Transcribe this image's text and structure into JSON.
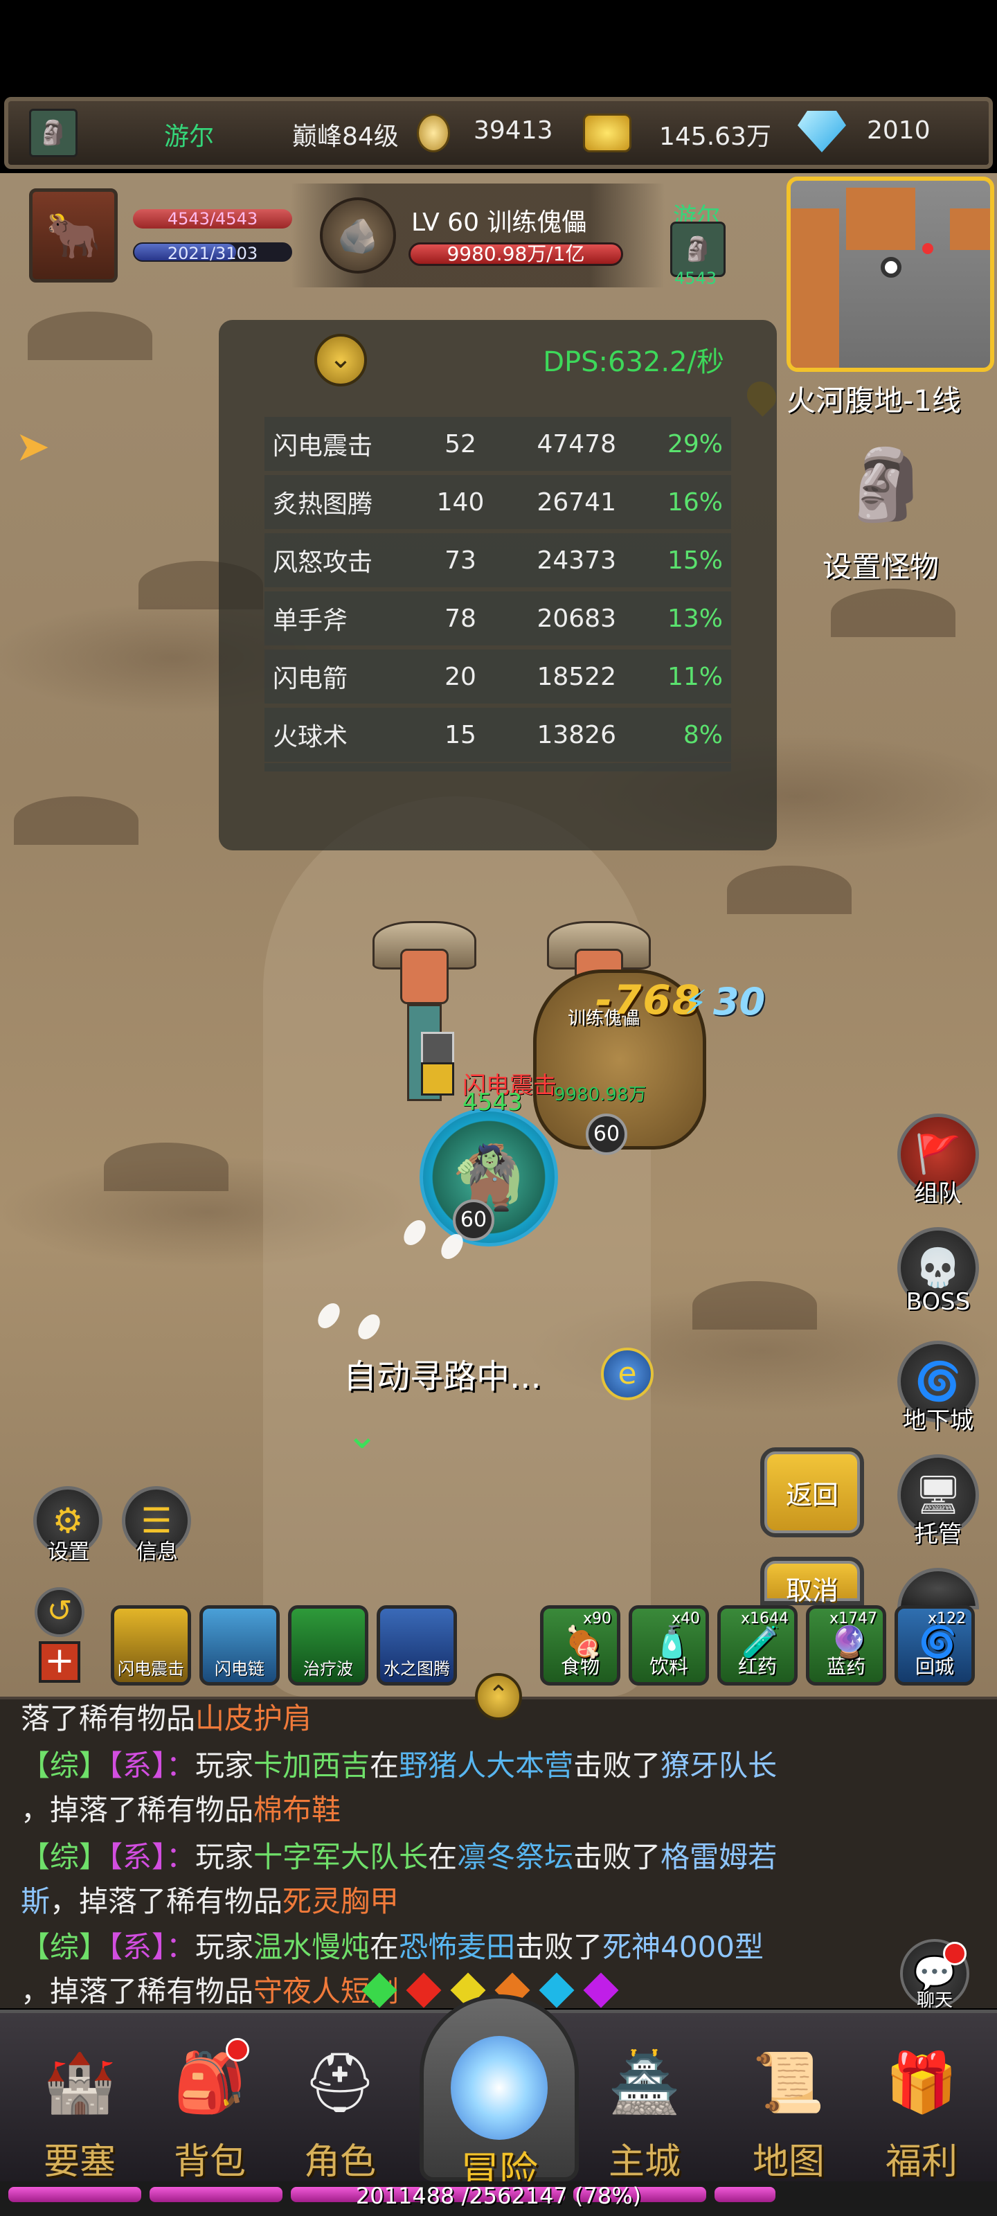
{
  "resources": {
    "player_name": "游尔",
    "rank": "巅峰84级",
    "currency1": "39413",
    "gold": "145.63万",
    "diamonds": "2010"
  },
  "player": {
    "hp": "4543/4543",
    "mp": "2021/3103",
    "mp_fraction": 0.65
  },
  "target": {
    "name": "LV 60 训练傀儡",
    "hp": "9980.98万/1亿",
    "ally_name": "游尔",
    "ally_sub": "4543"
  },
  "map": {
    "location": "火河腹地-1线",
    "set_monster": "设置怪物"
  },
  "dps": {
    "title": "DPS:632.2/秒",
    "rows": [
      {
        "name": "闪电震击",
        "count": "52",
        "damage": "47478",
        "pct": "29%"
      },
      {
        "name": "炙热图腾",
        "count": "140",
        "damage": "26741",
        "pct": "16%"
      },
      {
        "name": "风怒攻击",
        "count": "73",
        "damage": "24373",
        "pct": "15%"
      },
      {
        "name": "单手斧",
        "count": "78",
        "damage": "20683",
        "pct": "13%"
      },
      {
        "name": "闪电箭",
        "count": "20",
        "damage": "18522",
        "pct": "11%"
      },
      {
        "name": "火球术",
        "count": "15",
        "damage": "13826",
        "pct": "8%"
      }
    ]
  },
  "battle": {
    "golem_name": "训练傀儡",
    "golem_hp": "9980.98万",
    "damage": "-768",
    "combo": "30",
    "golem_level": "60",
    "hero_level": "60",
    "pop_skill": "闪电震击",
    "pop_num": "4543",
    "auto_path": "自动寻路中..."
  },
  "right_buttons": [
    {
      "label": "组队",
      "icon": "banner-icon"
    },
    {
      "label": "BOSS",
      "icon": "skull-icon"
    },
    {
      "label": "地下城",
      "icon": "dungeon-icon"
    },
    {
      "label": "托管",
      "icon": "monitor-icon"
    }
  ],
  "left_buttons": {
    "settings": "设置",
    "info": "信息",
    "back": "返回",
    "cancel": "取消"
  },
  "skills": [
    {
      "label": "闪电震击",
      "color": "#e3b528"
    },
    {
      "label": "闪电链",
      "color": "#4aa0d8"
    },
    {
      "label": "治疗波",
      "color": "#2e9a3a"
    },
    {
      "label": "水之图腾",
      "color": "#3a6ab8"
    }
  ],
  "items": [
    {
      "label": "食物",
      "qty": "x90",
      "icon": "🍖"
    },
    {
      "label": "饮料",
      "qty": "x40",
      "icon": "🧴"
    },
    {
      "label": "红药",
      "qty": "x1644",
      "icon": "🧪"
    },
    {
      "label": "蓝药",
      "qty": "x1747",
      "icon": "🔮"
    },
    {
      "label": "回城",
      "qty": "x122",
      "icon": "🌀"
    }
  ],
  "chat": {
    "line0": {
      "pre": "落了稀有物品",
      "item": "山皮护肩"
    },
    "line1": {
      "tag": "【综】",
      "sys": "【系】",
      "sep": "：",
      "word1": "玩家",
      "player": "卡加西吉",
      "at": "在",
      "place": "野猪人大本营",
      "beat": "击败了",
      "enemy": "獠牙队长"
    },
    "line1b": {
      "pre": "，掉落了稀有物品",
      "item": "棉布鞋"
    },
    "line2": {
      "tag": "【综】",
      "sys": "【系】",
      "sep": "：",
      "word1": "玩家",
      "player": "十字军大队长",
      "at": "在",
      "place": "凛冬祭坛",
      "beat": "击败了",
      "enemy": "格雷姆若"
    },
    "line2b": {
      "enemy_tail": "斯",
      "pre": "，掉落了稀有物品",
      "item": "死灵胸甲"
    },
    "line3": {
      "tag": "【综】",
      "sys": "【系】",
      "sep": "：",
      "word1": "玩家",
      "player": "温水慢炖",
      "at": "在",
      "place": "恐怖麦田",
      "beat": "击败了",
      "enemy": "死神4000型"
    },
    "line3b": {
      "pre": "，掉落了稀有物品",
      "item": "守夜人短剑"
    },
    "chat_button": "聊天"
  },
  "nav": [
    {
      "label": "要塞",
      "icon": "fortress-icon",
      "dot": false
    },
    {
      "label": "背包",
      "icon": "backpack-icon",
      "dot": true
    },
    {
      "label": "角色",
      "icon": "helmet-icon",
      "dot": false
    },
    {
      "label": "冒险",
      "icon": "portal-icon",
      "dot": false
    },
    {
      "label": "主城",
      "icon": "castle-icon",
      "dot": false
    },
    {
      "label": "地图",
      "icon": "scroll-icon",
      "dot": false
    },
    {
      "label": "福利",
      "icon": "gift-icon",
      "dot": false
    }
  ],
  "exp": {
    "text": "2011488 /2562147 (78%)",
    "fraction": 0.78
  }
}
